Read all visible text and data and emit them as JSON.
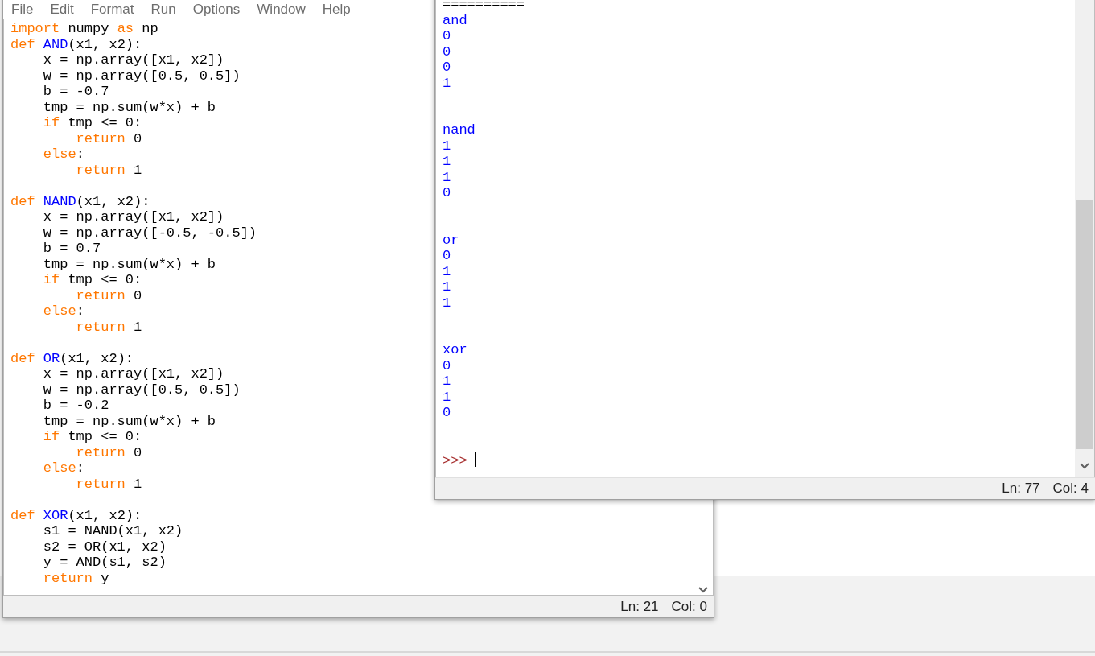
{
  "editor": {
    "menu": [
      "File",
      "Edit",
      "Format",
      "Run",
      "Options",
      "Window",
      "Help"
    ],
    "lines": [
      {
        "segments": [
          {
            "kind": "keyword",
            "text": "import"
          },
          {
            "kind": "plain",
            "text": " numpy "
          },
          {
            "kind": "keyword",
            "text": "as"
          },
          {
            "kind": "plain",
            "text": " np"
          }
        ]
      },
      {
        "segments": [
          {
            "kind": "keyword",
            "text": "def "
          },
          {
            "kind": "name",
            "text": "AND"
          },
          {
            "kind": "plain",
            "text": "(x1, x2):"
          }
        ]
      },
      {
        "segments": [
          {
            "kind": "plain",
            "text": "    x = np.array([x1, x2])"
          }
        ]
      },
      {
        "segments": [
          {
            "kind": "plain",
            "text": "    w = np.array([0.5, 0.5])"
          }
        ]
      },
      {
        "segments": [
          {
            "kind": "plain",
            "text": "    b = -0.7"
          }
        ]
      },
      {
        "segments": [
          {
            "kind": "plain",
            "text": "    tmp = np.sum(w*x) + b"
          }
        ]
      },
      {
        "segments": [
          {
            "kind": "keyword",
            "text": "    if"
          },
          {
            "kind": "plain",
            "text": " tmp <= 0:"
          }
        ]
      },
      {
        "segments": [
          {
            "kind": "keyword",
            "text": "        return"
          },
          {
            "kind": "plain",
            "text": " 0"
          }
        ]
      },
      {
        "segments": [
          {
            "kind": "keyword",
            "text": "    else"
          },
          {
            "kind": "plain",
            "text": ":"
          }
        ]
      },
      {
        "segments": [
          {
            "kind": "keyword",
            "text": "        return"
          },
          {
            "kind": "plain",
            "text": " 1"
          }
        ]
      },
      {
        "blank_before": true,
        "segments": [
          {
            "kind": "keyword",
            "text": "def "
          },
          {
            "kind": "name",
            "text": "NAND"
          },
          {
            "kind": "plain",
            "text": "(x1, x2):"
          }
        ]
      },
      {
        "segments": [
          {
            "kind": "plain",
            "text": "    x = np.array([x1, x2])"
          }
        ]
      },
      {
        "segments": [
          {
            "kind": "plain",
            "text": "    w = np.array([-0.5, -0.5])"
          }
        ]
      },
      {
        "segments": [
          {
            "kind": "plain",
            "text": "    b = 0.7"
          }
        ]
      },
      {
        "segments": [
          {
            "kind": "plain",
            "text": "    tmp = np.sum(w*x) + b"
          }
        ]
      },
      {
        "segments": [
          {
            "kind": "keyword",
            "text": "    if"
          },
          {
            "kind": "plain",
            "text": " tmp <= 0:"
          }
        ]
      },
      {
        "segments": [
          {
            "kind": "keyword",
            "text": "        return"
          },
          {
            "kind": "plain",
            "text": " 0"
          }
        ]
      },
      {
        "segments": [
          {
            "kind": "keyword",
            "text": "    else"
          },
          {
            "kind": "plain",
            "text": ":"
          }
        ]
      },
      {
        "segments": [
          {
            "kind": "keyword",
            "text": "        return"
          },
          {
            "kind": "plain",
            "text": " 1"
          }
        ]
      },
      {
        "blank_before": true,
        "segments": [
          {
            "kind": "keyword",
            "text": "def "
          },
          {
            "kind": "name",
            "text": "OR"
          },
          {
            "kind": "plain",
            "text": "(x1, x2):"
          }
        ]
      },
      {
        "segments": [
          {
            "kind": "plain",
            "text": "    x = np.array([x1, x2])"
          }
        ]
      },
      {
        "segments": [
          {
            "kind": "plain",
            "text": "    w = np.array([0.5, 0.5])"
          }
        ]
      },
      {
        "segments": [
          {
            "kind": "plain",
            "text": "    b = -0.2"
          }
        ]
      },
      {
        "segments": [
          {
            "kind": "plain",
            "text": "    tmp = np.sum(w*x) + b"
          }
        ]
      },
      {
        "segments": [
          {
            "kind": "keyword",
            "text": "    if"
          },
          {
            "kind": "plain",
            "text": " tmp <= 0:"
          }
        ]
      },
      {
        "segments": [
          {
            "kind": "keyword",
            "text": "        return"
          },
          {
            "kind": "plain",
            "text": " 0"
          }
        ]
      },
      {
        "segments": [
          {
            "kind": "keyword",
            "text": "    else"
          },
          {
            "kind": "plain",
            "text": ":"
          }
        ]
      },
      {
        "segments": [
          {
            "kind": "keyword",
            "text": "        return"
          },
          {
            "kind": "plain",
            "text": " 1"
          }
        ]
      },
      {
        "blank_before": true,
        "segments": [
          {
            "kind": "keyword",
            "text": "def "
          },
          {
            "kind": "name",
            "text": "XOR"
          },
          {
            "kind": "plain",
            "text": "(x1, x2):"
          }
        ]
      },
      {
        "segments": [
          {
            "kind": "plain",
            "text": "    s1 = NAND(x1, x2)"
          }
        ]
      },
      {
        "segments": [
          {
            "kind": "plain",
            "text": "    s2 = OR(x1, x2)"
          }
        ]
      },
      {
        "segments": [
          {
            "kind": "plain",
            "text": "    y = AND(s1, s2)"
          }
        ]
      },
      {
        "segments": [
          {
            "kind": "keyword",
            "text": "    return"
          },
          {
            "kind": "plain",
            "text": " y"
          }
        ]
      }
    ],
    "status": {
      "line": "Ln: 21",
      "column": "Col: 0"
    }
  },
  "shell": {
    "lines": [
      {
        "kind": "rule",
        "text": "=========="
      },
      {
        "kind": "output",
        "text": "and"
      },
      {
        "kind": "output",
        "text": "0"
      },
      {
        "kind": "output",
        "text": "0"
      },
      {
        "kind": "output",
        "text": "0"
      },
      {
        "kind": "output",
        "text": "1"
      },
      {
        "kind": "output",
        "text": "nand",
        "gap_before": true
      },
      {
        "kind": "output",
        "text": "1"
      },
      {
        "kind": "output",
        "text": "1"
      },
      {
        "kind": "output",
        "text": "1"
      },
      {
        "kind": "output",
        "text": "0"
      },
      {
        "kind": "output",
        "text": "or",
        "gap_before": true
      },
      {
        "kind": "output",
        "text": "0"
      },
      {
        "kind": "output",
        "text": "1"
      },
      {
        "kind": "output",
        "text": "1"
      },
      {
        "kind": "output",
        "text": "1"
      },
      {
        "kind": "output",
        "text": "xor",
        "gap_before": true
      },
      {
        "kind": "output",
        "text": "0"
      },
      {
        "kind": "output",
        "text": "1"
      },
      {
        "kind": "output",
        "text": "1"
      },
      {
        "kind": "output",
        "text": "0"
      },
      {
        "kind": "prompt",
        "text": ">>>",
        "gap_before": true
      }
    ],
    "status": {
      "line": "Ln: 77",
      "column": "Col: 4"
    }
  }
}
